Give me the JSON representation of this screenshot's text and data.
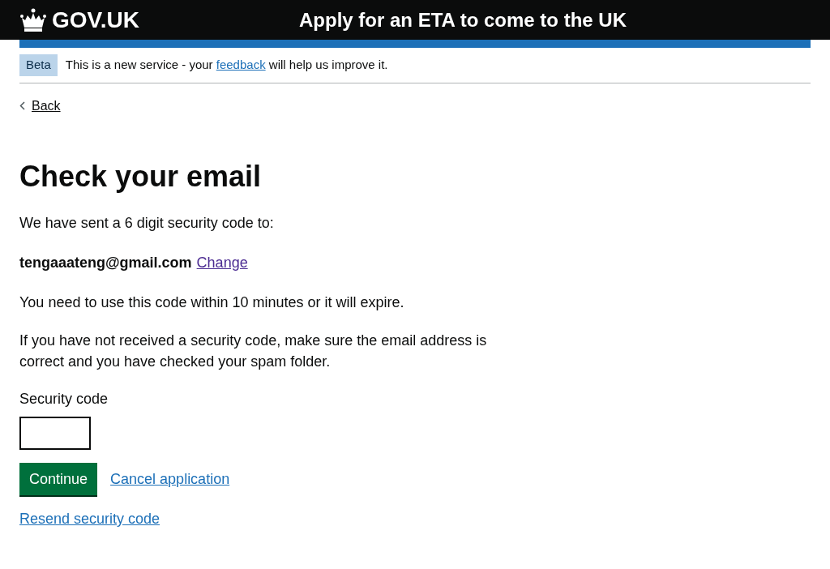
{
  "header": {
    "logo": "GOV.UK",
    "service_name": "Apply for an ETA to come to the UK"
  },
  "phase_banner": {
    "tag": "Beta",
    "text_before": "This is a new service - your ",
    "link": "feedback",
    "text_after": " will help us improve it."
  },
  "back_link": "Back",
  "heading": "Check your email",
  "sent_text": "We have sent a 6 digit security code to:",
  "email": "tengaaateng@gmail.com",
  "change_link": {
    "label": "Change",
    "visited": true
  },
  "expiry_text": "You need to use this code within 10 minutes or it will expire.",
  "help_text": "If you have not received a security code, make sure the email address is correct and you have checked your spam folder.",
  "field": {
    "label": "Security code"
  },
  "continue_button": "Continue",
  "cancel_link": {
    "label": "Cancel application",
    "visited": false
  },
  "resend_link": {
    "label": "Resend security code",
    "visited": false
  }
}
